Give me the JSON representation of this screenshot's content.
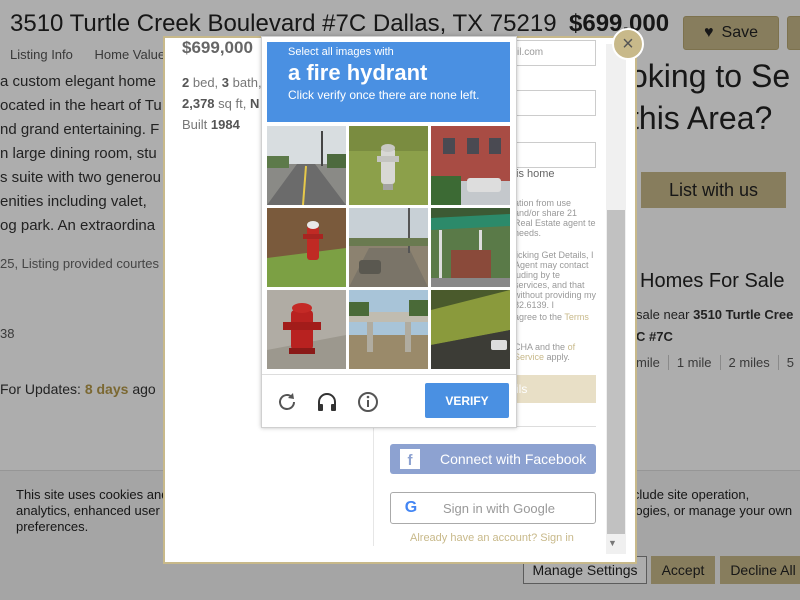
{
  "listing": {
    "title": "3510 Turtle Creek Boulevard #7C Dallas, TX 75219",
    "price": "$699,000",
    "nav": [
      "Listing Info",
      "Home Value E"
    ],
    "save_label": "Save",
    "description": [
      "a custom elegant home",
      "ocated in the heart of Tu",
      "nd grand entertaining. F",
      "n large dining room, stu",
      "s suite with two generou",
      "enities including valet,",
      "og park. An extraordina"
    ],
    "courtesy": "25, Listing provided courtes",
    "stray_number": "38",
    "updates_prefix": "For Updates:",
    "updates_days": "8 days",
    "updates_suffix": "ago"
  },
  "sidebar": {
    "heading_line1": "oking to Se",
    "heading_line2": "this Area?",
    "list_button": "List with us",
    "homes_title": "Homes For Sale",
    "homes_sub_prefix": "sale near",
    "homes_sub_address": "3510 Turtle Cree",
    "homes_sub_unit": "C #7C",
    "distances": [
      "mile",
      "1 mile",
      "2 miles",
      "5"
    ]
  },
  "cookie": {
    "text": "This site uses cookies and related technologies, as described in our privacy policy, for purposes that may include site operation, analytics, enhanced user experience, or advertising. You may choose to consent to our use of these technologies, or manage your own preferences.",
    "manage": "Manage Settings",
    "accept": "Accept",
    "decline": "Decline All"
  },
  "modal": {
    "price": "$699,000",
    "beds": "2",
    "beds_label": "bed,",
    "baths": "3",
    "baths_label": "bath,",
    "sqft": "2,378",
    "sqft_label": "sq ft,",
    "sqft_suffix": "N",
    "built_label": "Built",
    "built_year": "1984",
    "email_placeholder": "il.com",
    "home_label": "is home",
    "disclaimer_1": "ation from use and/or share 21 Real Estate agent te needs.",
    "disclaimer_2": "licking Get Details, I Agent may contact luding by te services, and that without providing my 82.6139. I",
    "disclaimer_3a": "agree to the",
    "disclaimer_3b": "Terms",
    "disclaimer_4a": "CHA and the",
    "disclaimer_4b": "of Service",
    "disclaimer_4c": "apply.",
    "get_details": "ils",
    "or_text": "or",
    "facebook": "Connect with Facebook",
    "google": "Sign in with Google",
    "already": "Already have an account? Sign in",
    "close_symbol": "×"
  },
  "captcha": {
    "instruction_small": "Select all images with",
    "target": "a fire hydrant",
    "instruction_note": "Click verify once there are none left.",
    "verify": "VERIFY",
    "icons": [
      "reload-icon",
      "headphones-icon",
      "info-icon"
    ]
  },
  "colors": {
    "gold": "#c8b98a",
    "captcha_blue": "#4a90e2",
    "facebook_blue": "#8da2d1"
  }
}
